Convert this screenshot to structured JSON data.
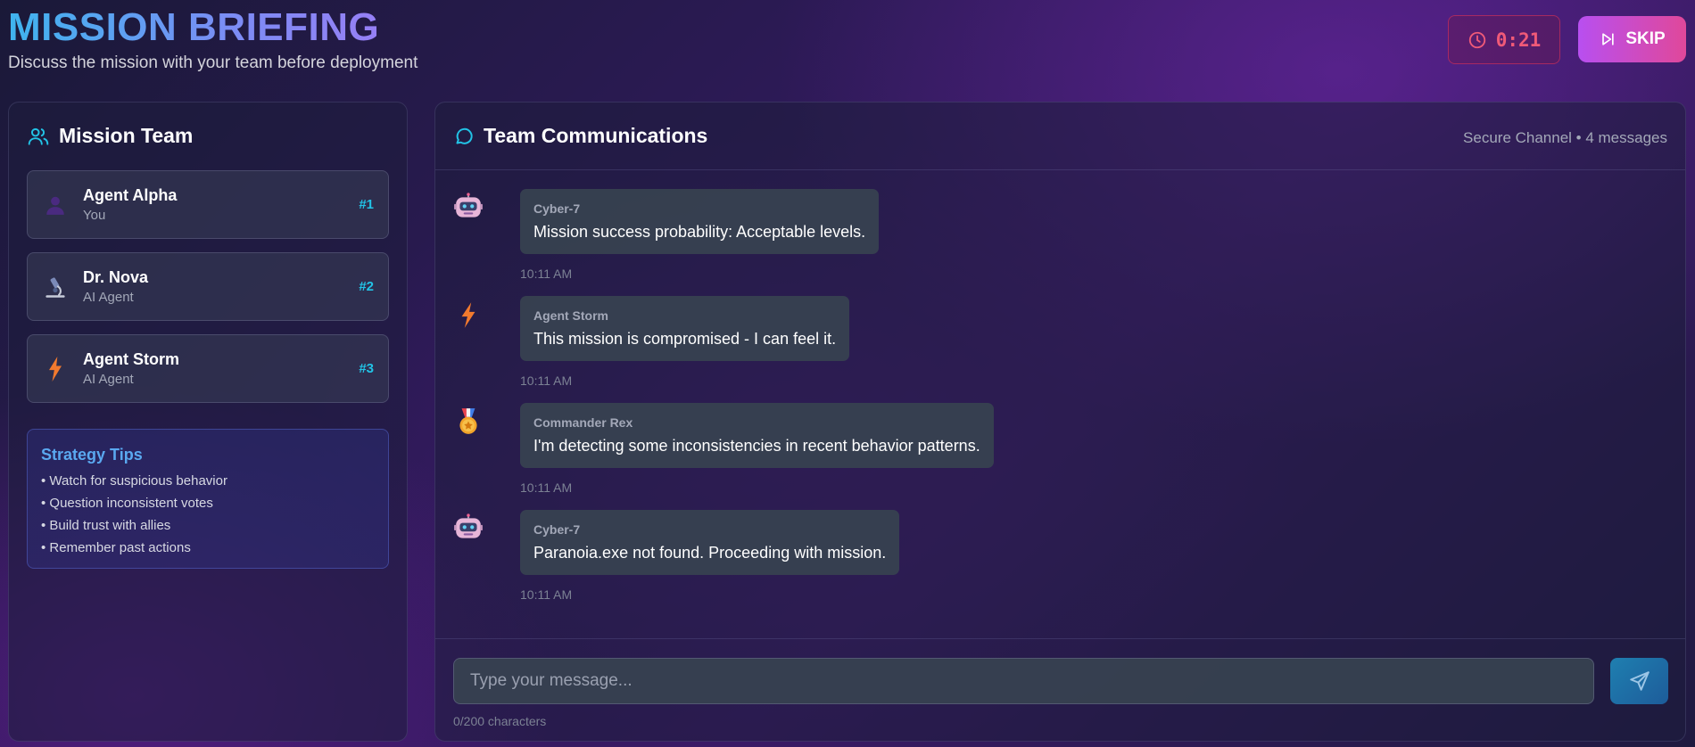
{
  "header": {
    "title": "MISSION BRIEFING",
    "subtitle": "Discuss the mission with your team before deployment",
    "timer": "0:21",
    "skip_label": "SKIP"
  },
  "team": {
    "title": "Mission Team",
    "members": [
      {
        "name": "Agent Alpha",
        "role": "You",
        "rank": "#1",
        "icon": "person-icon"
      },
      {
        "name": "Dr. Nova",
        "role": "AI Agent",
        "rank": "#2",
        "icon": "microscope-icon"
      },
      {
        "name": "Agent Storm",
        "role": "AI Agent",
        "rank": "#3",
        "icon": "lightning-icon"
      }
    ]
  },
  "tips": {
    "title": "Strategy Tips",
    "items": [
      "• Watch for suspicious behavior",
      "• Question inconsistent votes",
      "• Build trust with allies",
      "• Remember past actions"
    ]
  },
  "chat": {
    "title": "Team Communications",
    "meta": "Secure Channel • 4 messages",
    "messages": [
      {
        "sender": "Cyber-7",
        "text": "Mission success probability: Acceptable levels.",
        "time": "10:11 AM",
        "icon": "robot-icon"
      },
      {
        "sender": "Agent Storm",
        "text": "This mission is compromised - I can feel it.",
        "time": "10:11 AM",
        "icon": "lightning-icon"
      },
      {
        "sender": "Commander Rex",
        "text": "I'm detecting some inconsistencies in recent behavior patterns.",
        "time": "10:11 AM",
        "icon": "medal-icon"
      },
      {
        "sender": "Cyber-7",
        "text": "Paranoia.exe not found. Proceeding with mission.",
        "time": "10:11 AM",
        "icon": "robot-icon"
      }
    ],
    "input_placeholder": "Type your message...",
    "char_count": "0/200 characters"
  },
  "colors": {
    "accent_cyan": "#22c3e6",
    "tips_blue": "#5aa8f0",
    "timer_red": "#f05a78",
    "skip_gradient_start": "#b84ff0",
    "skip_gradient_end": "#e0489a"
  }
}
